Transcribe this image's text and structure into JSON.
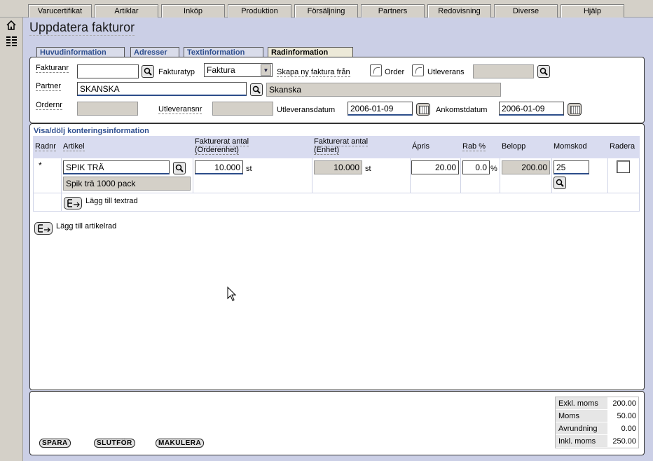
{
  "menu": [
    "Varucertifikat",
    "Artiklar",
    "Inköp",
    "Produktion",
    "Försäljning",
    "Partners",
    "Redovisning",
    "Diverse",
    "Hjälp"
  ],
  "page_title": "Uppdatera fakturor",
  "subtabs": [
    "Huvudinformation",
    "Adresser",
    "Textinformation",
    "Radinformation"
  ],
  "header": {
    "fakturanr_label": "Fakturanr",
    "fakturanr_value": "",
    "fakturatyp_label": "Fakturatyp",
    "fakturatyp_value": "Faktura",
    "skapa_label": "Skapa ny faktura från",
    "order_label": "Order",
    "utleverans_label": "Utleverans",
    "partner_label": "Partner",
    "partner_value": "SKANSKA",
    "partner_name": "Skanska",
    "ordernr_label": "Ordernr",
    "utleveransnr_label": "Utleveransnr",
    "utleveransdatum_label": "Utleveransdatum",
    "utleveransdatum_value": "2006-01-09",
    "ankomstdatum_label": "Ankomstdatum",
    "ankomstdatum_value": "2006-01-09"
  },
  "rows_section": {
    "toggle_label": "Visa/dölj konteringsinformation",
    "columns": {
      "radnr": "Radnr",
      "artikel": "Artikel",
      "fakt_order_1": "Fakturerat antal",
      "fakt_order_2": "(Orderenhet)",
      "fakt_enhet_1": "Fakturerat antal",
      "fakt_enhet_2": "(Enhet)",
      "apris": "Ápris",
      "rab": "Rab %",
      "belopp": "Belopp",
      "momskod": "Momskod",
      "radera": "Radera"
    },
    "row": {
      "radnr": "*",
      "artikel": "SPIK TRÄ",
      "artikel_desc": "Spik trä 1000 pack",
      "antal_order": "10.000",
      "unit_order": "st",
      "antal_enhet": "10.000",
      "unit_enhet": "st",
      "apris": "20.00",
      "rab": "0.0",
      "rab_unit": "%",
      "belopp": "200.00",
      "momskod": "25"
    },
    "add_text_row": "Lägg till textrad",
    "add_article_row": "Lägg till artikelrad"
  },
  "footer": {
    "buttons": [
      "SPARA",
      "SLUTFÖR",
      "MAKULERA"
    ],
    "summary": [
      {
        "label": "Exkl. moms",
        "value": "200.00"
      },
      {
        "label": "Moms",
        "value": "50.00"
      },
      {
        "label": "Avrundning",
        "value": "0.00"
      },
      {
        "label": "Inkl. moms",
        "value": "250.00"
      }
    ]
  }
}
